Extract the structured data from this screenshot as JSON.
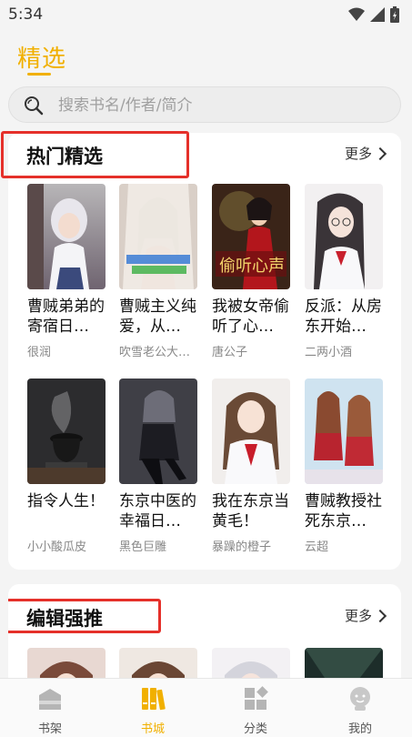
{
  "status": {
    "time": "5:34"
  },
  "header": {
    "title": "精选"
  },
  "search": {
    "placeholder": "搜索书名/作者/简介"
  },
  "sections": [
    {
      "title": "热门精选",
      "more": "更多",
      "books": [
        {
          "title": "曹贼弟弟的寄宿日…",
          "author": "很润"
        },
        {
          "title": "曹贼主义纯爱，从…",
          "author": "吹雪老公大…"
        },
        {
          "title": "我被女帝偷听了心…",
          "author": "唐公子"
        },
        {
          "title": "反派：从房东开始…",
          "author": "二两小酒"
        },
        {
          "title": "指令人生！",
          "author": "小小酸瓜皮"
        },
        {
          "title": "东京中医的幸福日…",
          "author": "黑色巨雕"
        },
        {
          "title": "我在东京当黄毛！",
          "author": "暴躁的橙子"
        },
        {
          "title": "曹贼教授社死东京…",
          "author": "云超"
        }
      ]
    },
    {
      "title": "编辑强推",
      "more": "更多"
    }
  ],
  "tabs": [
    {
      "label": "书架",
      "icon": "bookshelf-icon",
      "active": false
    },
    {
      "label": "书城",
      "icon": "bookstore-icon",
      "active": true
    },
    {
      "label": "分类",
      "icon": "category-icon",
      "active": false
    },
    {
      "label": "我的",
      "icon": "profile-icon",
      "active": false
    }
  ],
  "colors": {
    "accent": "#f1b000",
    "annotation": "#e5302a"
  }
}
